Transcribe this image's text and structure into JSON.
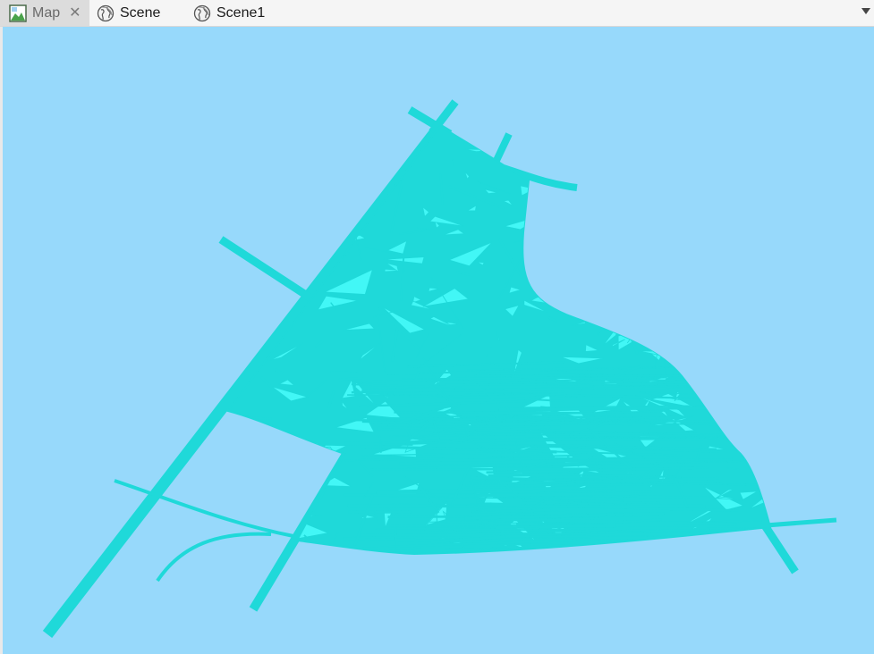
{
  "tabs": [
    {
      "label": "Map",
      "icon": "map-icon",
      "active": true,
      "closable": true,
      "close_glyph": "✕"
    },
    {
      "label": "Scene",
      "icon": "globe-icon",
      "active": false,
      "closable": false
    },
    {
      "label": "Scene1",
      "icon": "globe-icon",
      "active": false,
      "closable": false
    }
  ],
  "colors": {
    "background": "#97d9fb",
    "mesh_fill": "#42f7f6",
    "mesh_stroke": "#1fd9d9",
    "road": "#1fd9d9"
  }
}
